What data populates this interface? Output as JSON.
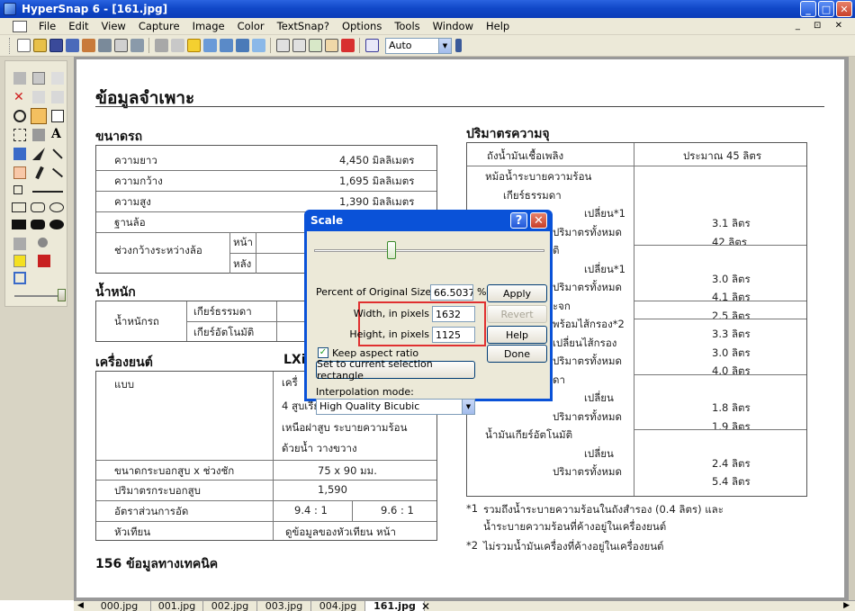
{
  "window": {
    "title": "HyperSnap 6 - [161.jpg]",
    "min": "_",
    "max": "□",
    "close": "✕"
  },
  "menu": [
    "File",
    "Edit",
    "View",
    "Capture",
    "Image",
    "Color",
    "TextSnap?",
    "Options",
    "Tools",
    "Window",
    "Help"
  ],
  "mdi_controls": "_ ⊡ ✕",
  "toolbar": {
    "zoom_value": "Auto"
  },
  "document": {
    "title": "ข้อมูลจำเพาะ",
    "dimensions": {
      "heading": "ขนาดรถ",
      "rows": [
        {
          "label": "ความยาว",
          "value": "4,450 มิลลิเมตร"
        },
        {
          "label": "ความกว้าง",
          "value": "1,695 มิลลิเมตร"
        },
        {
          "label": "ความสูง",
          "value": "1,390 มิลลิเมตร"
        },
        {
          "label": "ฐานล้อ",
          "value": ""
        }
      ],
      "track_label": "ช่วงกว้างระหว่างล้อ",
      "track_front": "หน้า",
      "track_rear": "หลัง"
    },
    "weight": {
      "heading": "น้ำหนัก",
      "label": "น้ำหนักรถ",
      "manual": "เกียร์ธรรมดา",
      "auto": "เกียร์อัตโนมัติ"
    },
    "engine": {
      "heading": "เครื่องยนต์",
      "model_header": "LXi",
      "type_label": "แบบ",
      "type_lines": [
        "เครื่",
        "4 สูบเรียง วาล์ว",
        "เหนือฝาสูบ ระบายความร้อน",
        "ด้วยน้ำ วางขวาง"
      ],
      "bore_label": "ขนาดกระบอกสูบ x ช่วงชัก",
      "bore_value": "75 x 90 มม.",
      "displacement_label": "ปริมาตรกระบอกสูบ",
      "displacement_value": "1,590",
      "compression_label": "อัตราส่วนการอัด",
      "compression_a": "9.4 : 1",
      "compression_b": "9.6 : 1",
      "spark_label": "หัวเทียน",
      "spark_value": "ดูข้อมูลของหัวเทียน หน้า"
    },
    "capacity": {
      "heading": "ปริมาตรความจุ",
      "fuel_label": "ถังน้ำมันเชื้อเพลิง",
      "fuel_value": "ประมาณ 45 ลิตร",
      "rows": [
        {
          "label": "หม้อน้ำระบายความร้อน",
          "value": ""
        },
        {
          "label": "เกียร์ธรรมดา",
          "value": ""
        },
        {
          "label": "เปลี่ยน*1",
          "value": "3.1 ลิตร"
        },
        {
          "label": "ปริมาตรทั้งหมด",
          "value": "42 ลิตร"
        },
        {
          "label": "ติ",
          "value": ""
        },
        {
          "label": "เปลี่ยน*1",
          "value": "3.0 ลิตร"
        },
        {
          "label": "ปริมาตรทั้งหมด",
          "value": "4.1 ลิตร"
        },
        {
          "label": "ะจก",
          "value": "2.5 ลิตร"
        },
        {
          "label": "พร้อมไส้กรอง*2",
          "value": "3.3 ลิตร"
        },
        {
          "label": "เปลี่ยนไส้กรอง",
          "value": "3.0 ลิตร"
        },
        {
          "label": "ปริมาตรทั้งหมด",
          "value": "4.0 ลิตร"
        },
        {
          "label": "ดา",
          "value": ""
        },
        {
          "label": "เปลี่ยน",
          "value": "1.8 ลิตร"
        },
        {
          "label": "ปริมาตรทั้งหมด",
          "value": "1.9 ลิตร"
        },
        {
          "label": "น้ำมันเกียร์อัตโนมัติ",
          "value": ""
        },
        {
          "label": "เปลี่ยน",
          "value": "2.4 ลิตร"
        },
        {
          "label": "ปริมาตรทั้งหมด",
          "value": "5.4 ลิตร"
        }
      ]
    },
    "footnotes": {
      "n1_mark": "*1",
      "n1_line1": "รวมถึงน้ำระบายความร้อนในถังสำรอง (0.4 ลิตร) และ",
      "n1_line2": "น้ำระบายความร้อนที่ค้างอยู่ในเครื่องยนต์",
      "n2_mark": "*2",
      "n2_line": "ไม่รวมน้ำมันเครื่องที่ค้างอยู่ในเครื่องยนต์"
    },
    "page_number": "156",
    "page_footer": "ข้อมูลทางเทคนิค"
  },
  "tabs": [
    "000.jpg",
    "001.jpg",
    "002.jpg",
    "003.jpg",
    "004.jpg",
    "161.jpg"
  ],
  "active_tab": "161.jpg",
  "dialog": {
    "title": "Scale",
    "help_icon": "?",
    "close_icon": "✕",
    "percent_label": "Percent of Original Size",
    "percent_value": "66.5037",
    "percent_unit": "%",
    "width_label": "Width, in pixels",
    "width_value": "1632",
    "height_label": "Height, in pixels",
    "height_value": "1125",
    "keep_aspect_label": "Keep aspect ratio",
    "set_selection_label": "Set to current selection rectangle",
    "interp_label": "Interpolation mode:",
    "interp_value": "High Quality Bicubic",
    "btn_apply": "Apply",
    "btn_revert": "Revert",
    "btn_help": "Help",
    "btn_done": "Done"
  },
  "colors": {
    "titlebar": "#0a52d8",
    "highlight": "#e03030",
    "chrome": "#ece9d8"
  }
}
